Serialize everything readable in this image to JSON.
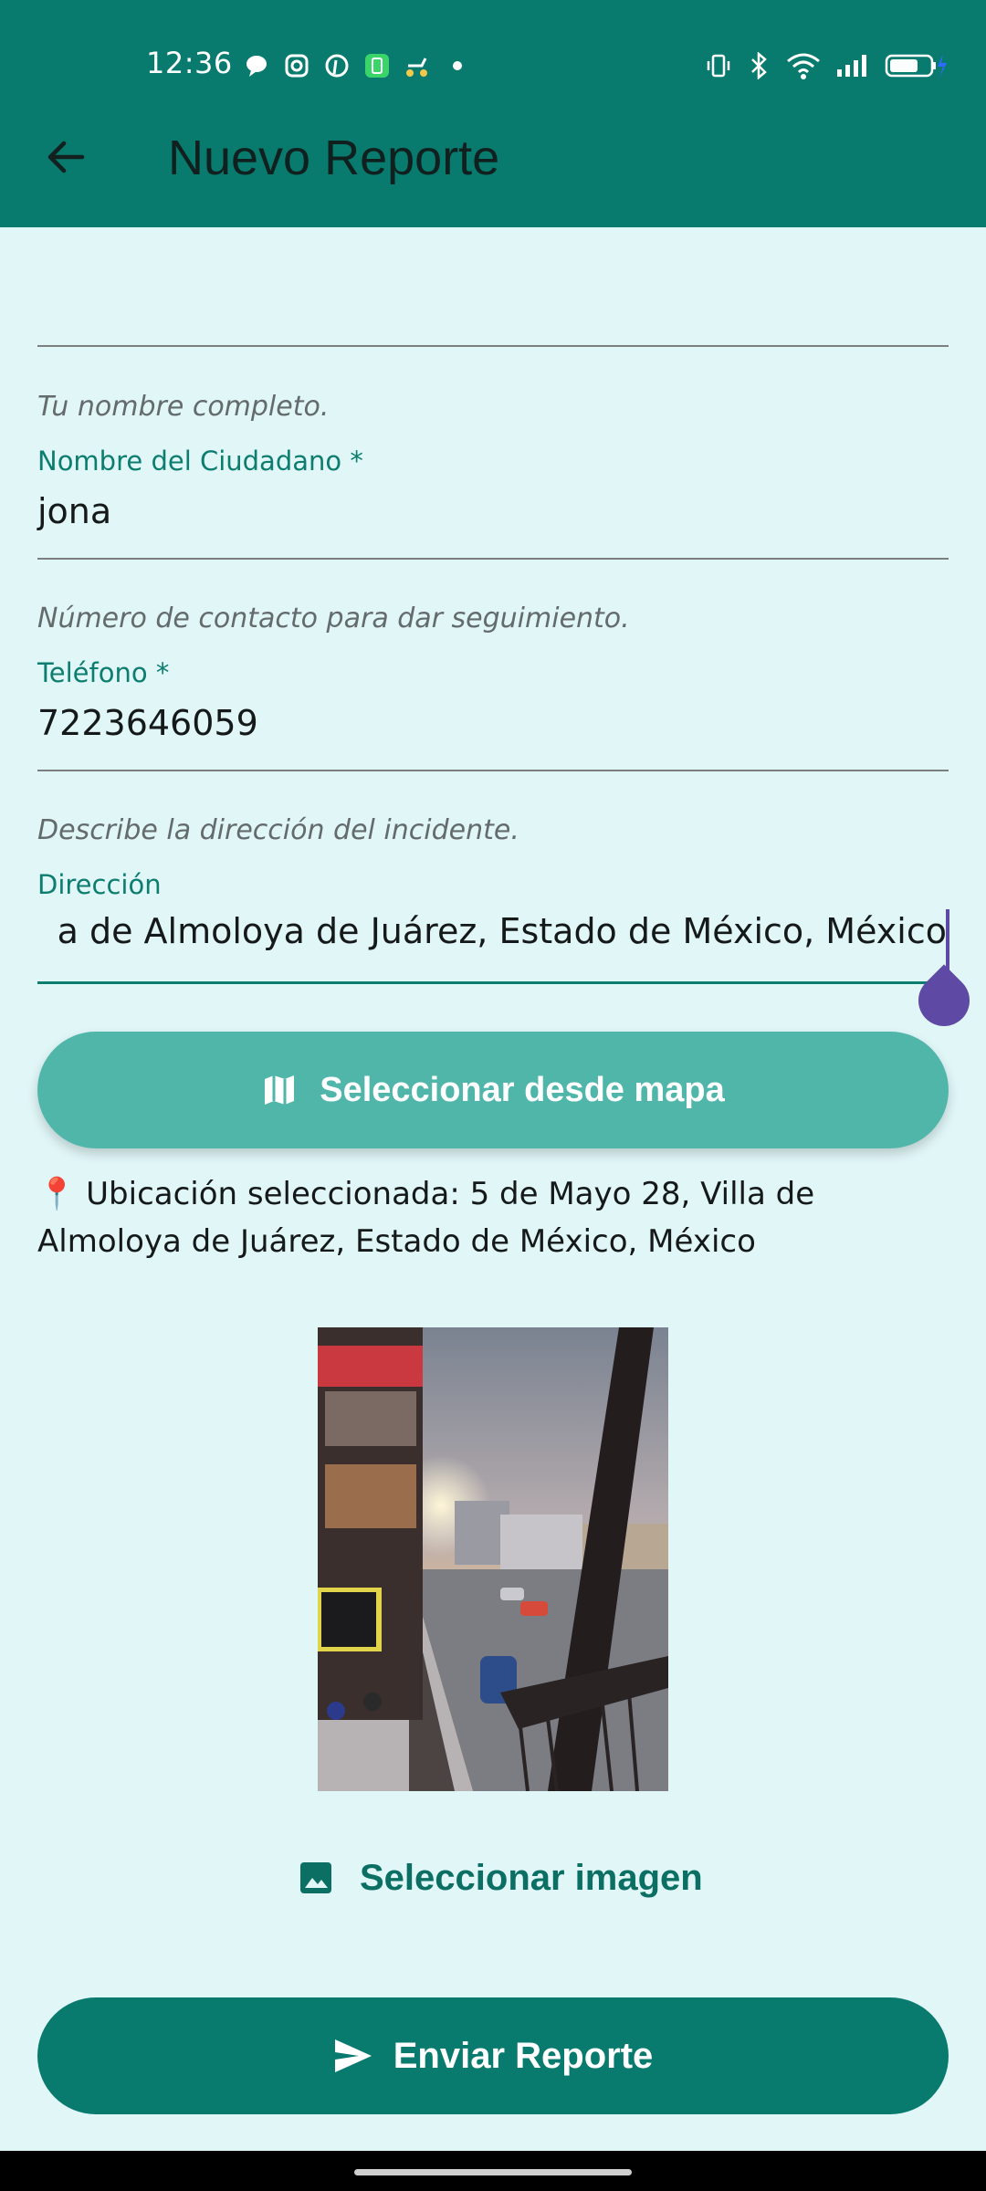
{
  "status_bar": {
    "time": "12:36"
  },
  "app_bar": {
    "title": "Nuevo Reporte"
  },
  "form": {
    "name_field": {
      "helper": "Tu nombre completo.",
      "label": "Nombre del Ciudadano *",
      "value": "jona"
    },
    "phone_field": {
      "helper": "Número de contacto para dar seguimiento.",
      "label": "Teléfono *",
      "value": "7223646059"
    },
    "address_field": {
      "helper": "Describe la dirección del incidente.",
      "label": "Dirección",
      "value": "a de Almoloya de Juárez, Estado de México, México"
    }
  },
  "map_button": {
    "label": "Seleccionar desde mapa",
    "icon": "map-icon"
  },
  "location": {
    "pin": "📍",
    "text": "Ubicación seleccionada: 5 de Mayo 28, Villa de Almoloya de Juárez, Estado de México, México"
  },
  "image_button": {
    "label": "Seleccionar imagen",
    "icon": "image-icon"
  },
  "submit_button": {
    "label": "Enviar Reporte",
    "icon": "send-icon"
  },
  "colors": {
    "app_bar": "#087A6E",
    "background": "#E0F6F7",
    "map_button": "#51B6AA",
    "primary": "#087A6E",
    "caret": "#5E4AA4"
  }
}
